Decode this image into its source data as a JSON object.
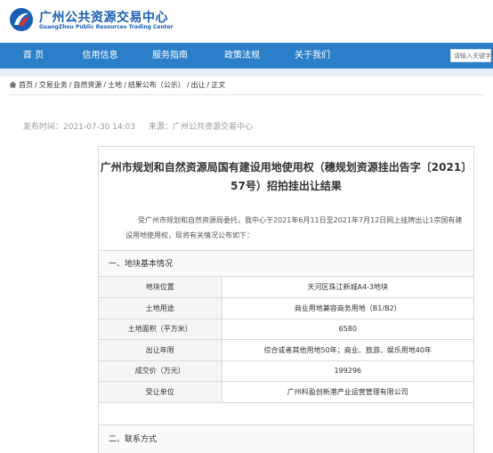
{
  "header": {
    "logo_cn": "广州公共资源交易中心",
    "logo_en": "GuangZhou Public Resources Trading Center"
  },
  "nav": {
    "items": [
      "首 页",
      "信用信息",
      "服务指南",
      "政策法规",
      "关于我们"
    ],
    "search_placeholder": "请输入关键字"
  },
  "breadcrumb": [
    "首页",
    "交易业务",
    "自然资源",
    "土地",
    "结果公布（公示）",
    "出让",
    "正文"
  ],
  "meta": {
    "publish_time": "发布时间：2021-07-30 14:03",
    "source": "来源：广州公共资源交易中心"
  },
  "article": {
    "title": "广州市规划和自然资源局国有建设用地使用权（穗规划资源挂出告字〔2021〕57号）招拍挂出让结果",
    "intro": "受广州市规划和自然资源局委托，我中心于2021年6月11日至2021年7月12日网上挂牌出让1宗国有建设用地使用权，现将有关情况公布如下：",
    "section1": "一、地块基本情况",
    "section2": "二、联系方式",
    "rows": [
      {
        "label": "地块位置",
        "value": "天河区珠江新城A4-3地块"
      },
      {
        "label": "土地用途",
        "value": "商业用地兼容商务用地（B1/B2）"
      },
      {
        "label": "土地面积（平方米）",
        "value": "6580"
      },
      {
        "label": "出让年限",
        "value": "综合或者其他用地50年；商业、旅游、娱乐用地40年"
      },
      {
        "label": "成交价（万元）",
        "value": "199296"
      },
      {
        "label": "受让单位",
        "value": "广州科盈创新港产业运营管理有限公司"
      }
    ]
  },
  "colors": {
    "nav_bg": "#2b7fc9",
    "logo_blue": "#1a5fb4",
    "logo_red": "#e5322d"
  }
}
